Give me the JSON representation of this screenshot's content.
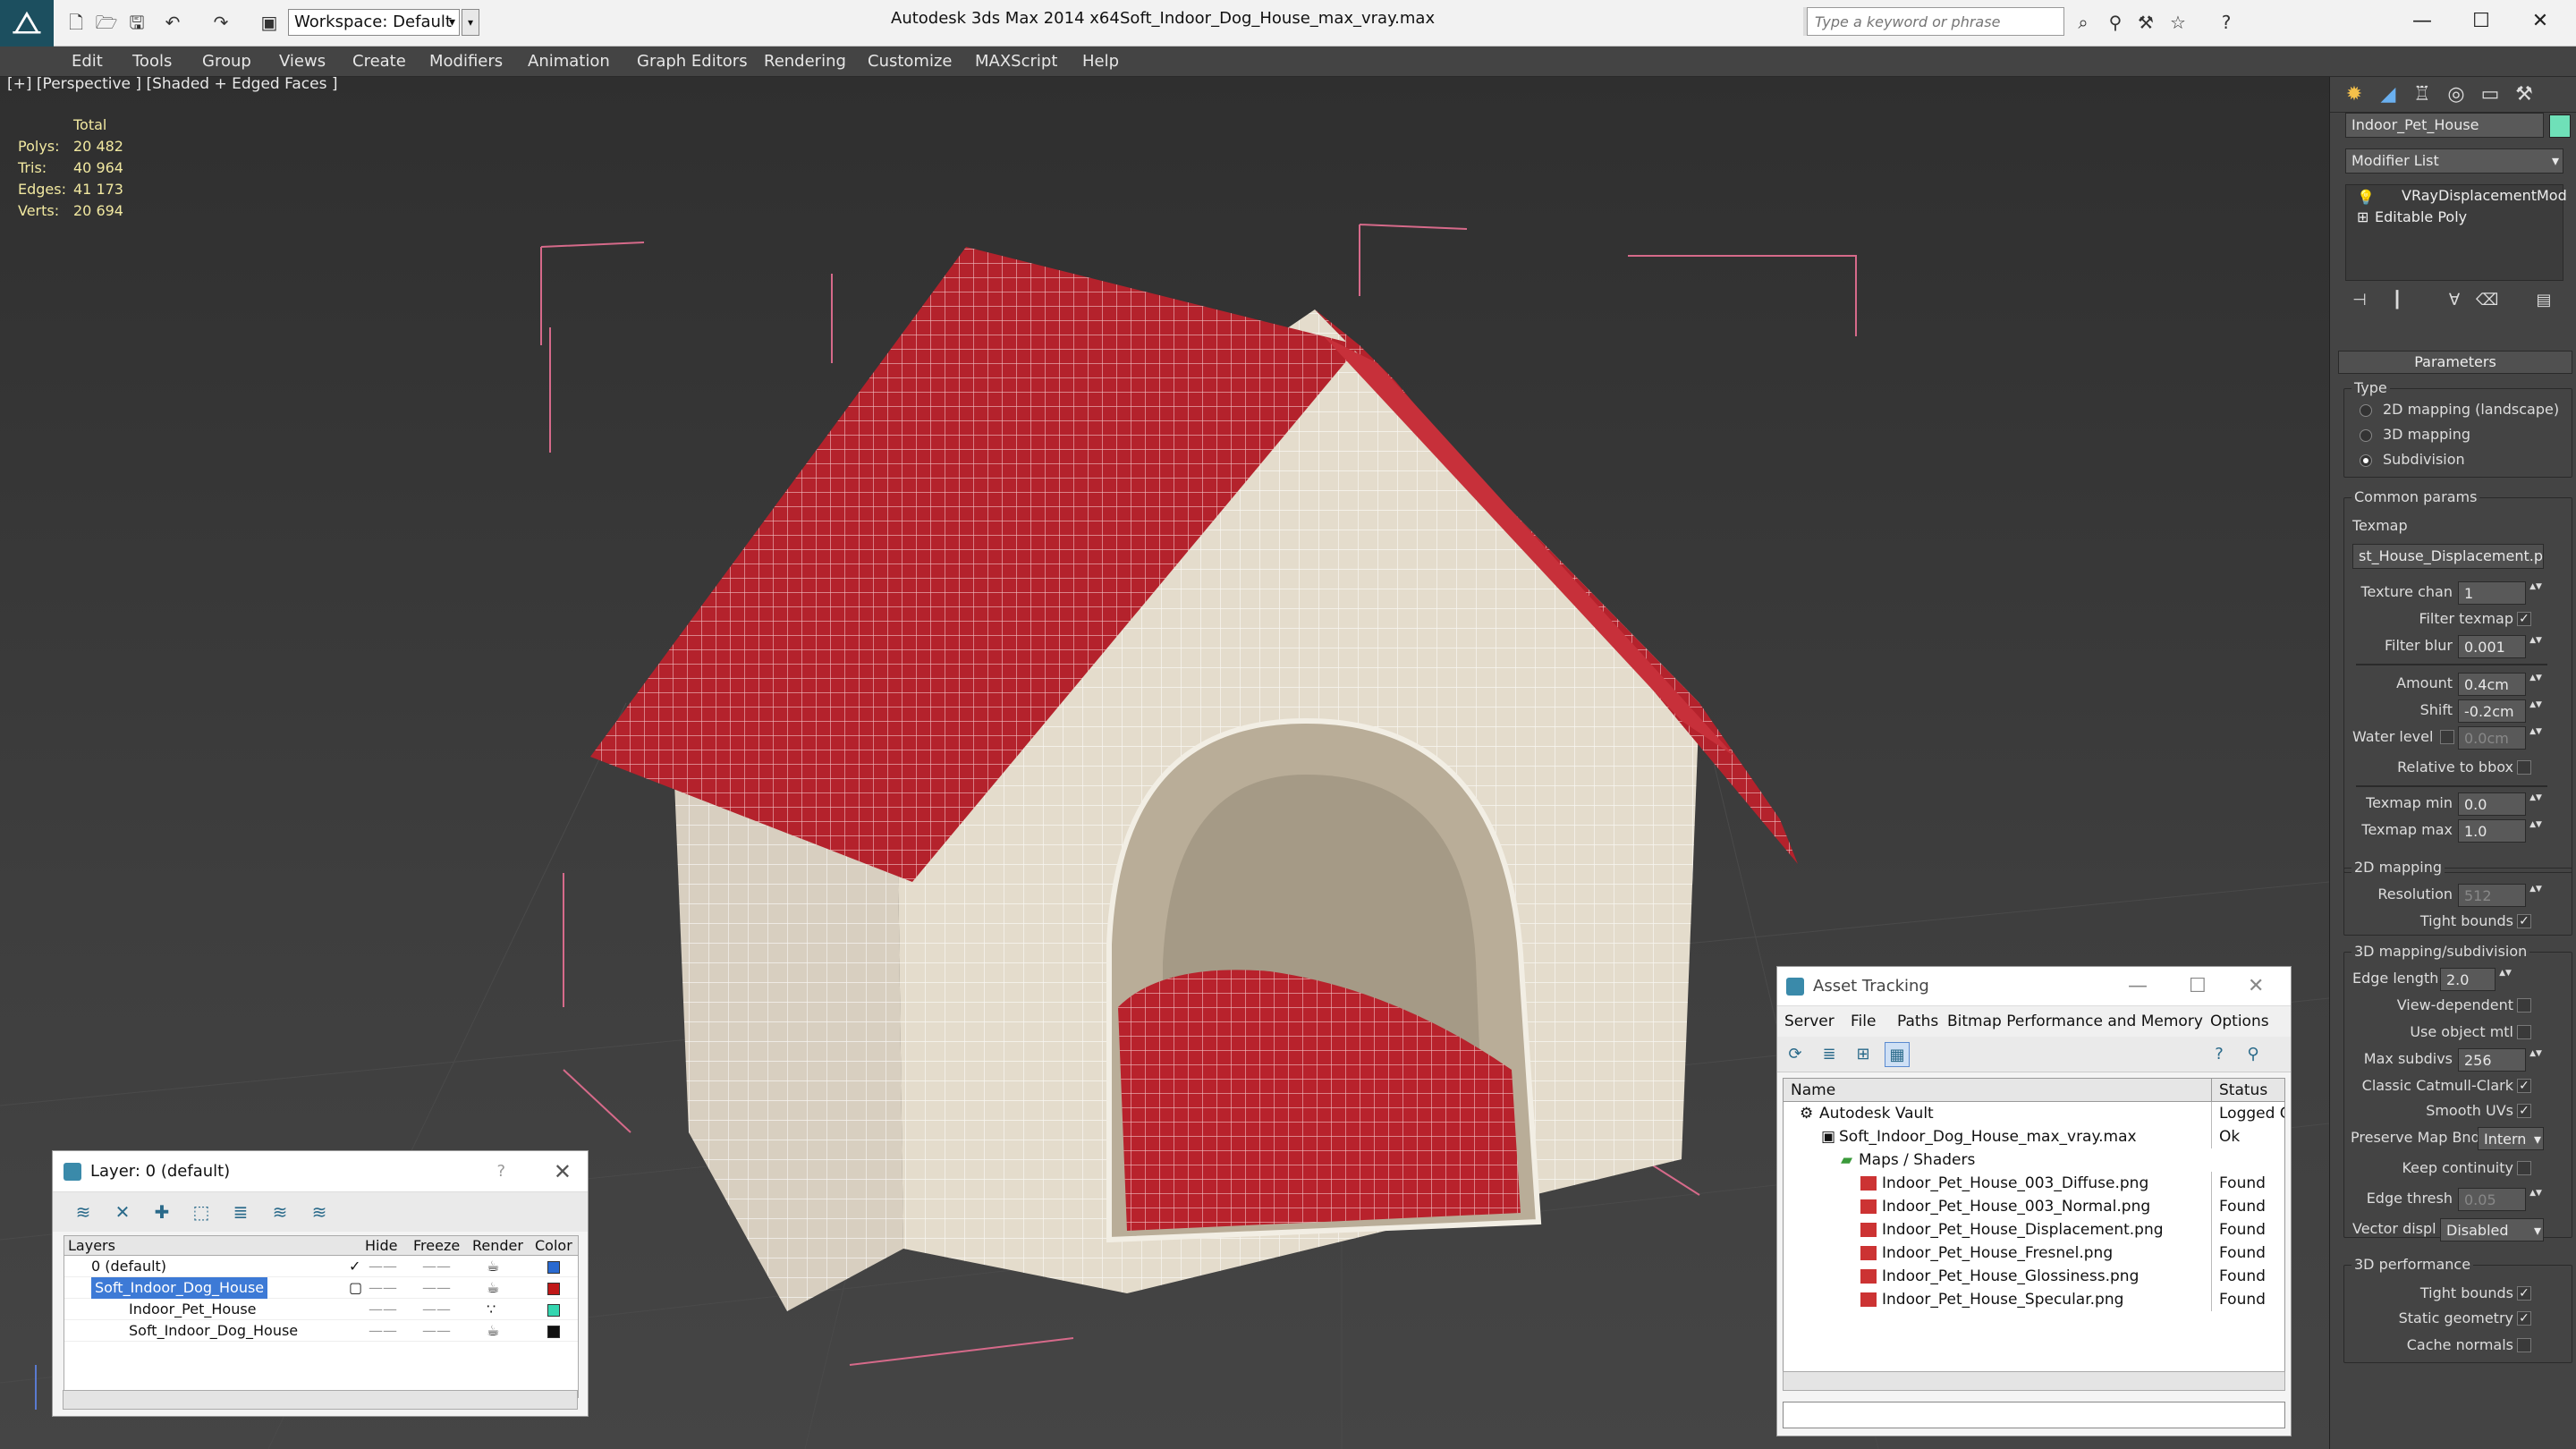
{
  "titlebar": {
    "app_title": "Autodesk 3ds Max  2014 x64",
    "file_title": "Soft_Indoor_Dog_House_max_vray.max",
    "workspace": "Workspace: Default",
    "search_placeholder": "Type a keyword or phrase"
  },
  "menu": [
    "Edit",
    "Tools",
    "Group",
    "Views",
    "Create",
    "Modifiers",
    "Animation",
    "Graph Editors",
    "Rendering",
    "Customize",
    "MAXScript",
    "Help"
  ],
  "viewport": {
    "label": "[+] [Perspective ] [Shaded + Edged Faces ]",
    "stats_header": "Total",
    "stats": [
      {
        "label": "Polys:",
        "value": "20 482"
      },
      {
        "label": "Tris:",
        "value": "40 964"
      },
      {
        "label": "Edges:",
        "value": "41 173"
      },
      {
        "label": "Verts:",
        "value": "20 694"
      }
    ]
  },
  "layer_window": {
    "title": "Layer: 0 (default)",
    "help": "?",
    "columns": [
      "Layers",
      "Hide",
      "Freeze",
      "Render",
      "Color"
    ],
    "rows": [
      {
        "name": "0 (default)",
        "color": "#2a6ad0",
        "indent": 0,
        "selected": false
      },
      {
        "name": "Soft_Indoor_Dog_House",
        "color": "#c01818",
        "indent": 0,
        "selected": true
      },
      {
        "name": "Indoor_Pet_House",
        "color": "#34d6b0",
        "indent": 1,
        "selected": false
      },
      {
        "name": "Soft_Indoor_Dog_House",
        "color": "#111111",
        "indent": 1,
        "selected": false
      }
    ]
  },
  "asset_window": {
    "title": "Asset Tracking",
    "menu": [
      "Server",
      "File",
      "Paths",
      "Bitmap Performance and Memory",
      "Options"
    ],
    "columns": [
      "Name",
      "Status"
    ],
    "rows": [
      {
        "name": "Autodesk Vault",
        "status": "Logged Ou",
        "indent": 0
      },
      {
        "name": "Soft_Indoor_Dog_House_max_vray.max",
        "status": "Ok",
        "indent": 1
      },
      {
        "name": "Maps / Shaders",
        "status": "",
        "indent": 2
      },
      {
        "name": "Indoor_Pet_House_003_Diffuse.png",
        "status": "Found",
        "indent": 3
      },
      {
        "name": "Indoor_Pet_House_003_Normal.png",
        "status": "Found",
        "indent": 3
      },
      {
        "name": "Indoor_Pet_House_Displacement.png",
        "status": "Found",
        "indent": 3
      },
      {
        "name": "Indoor_Pet_House_Fresnel.png",
        "status": "Found",
        "indent": 3
      },
      {
        "name": "Indoor_Pet_House_Glossiness.png",
        "status": "Found",
        "indent": 3
      },
      {
        "name": "Indoor_Pet_House_Specular.png",
        "status": "Found",
        "indent": 3
      }
    ]
  },
  "command_panel": {
    "object_name": "Indoor_Pet_House",
    "object_color": "#6fe0b8",
    "modifier_list": "Modifier List",
    "stack": [
      "VRayDisplacementMod",
      "Editable Poly"
    ],
    "parameters_title": "Parameters",
    "type_label": "Type",
    "type_options": [
      "2D mapping (landscape)",
      "3D mapping",
      "Subdivision"
    ],
    "type_selected": 2,
    "common_params": "Common params",
    "texmap_label": "Texmap",
    "texmap_value": "st_House_Displacement.png)",
    "texture_chan_label": "Texture chan",
    "texture_chan": "1",
    "filter_texmap": "Filter texmap",
    "filter_blur_label": "Filter blur",
    "filter_blur": "0.001",
    "amount_label": "Amount",
    "amount": "0.4cm",
    "shift_label": "Shift",
    "shift": "-0.2cm",
    "water_level_label": "Water level",
    "water_level": "0.0cm",
    "relative_bbox": "Relative to bbox",
    "texmap_min_label": "Texmap min",
    "texmap_min": "0.0",
    "texmap_max_label": "Texmap max",
    "texmap_max": "1.0",
    "mapping2d_title": "2D mapping",
    "resolution_label": "Resolution",
    "resolution": "512",
    "tight_bounds": "Tight bounds",
    "mapping3d_title": "3D mapping/subdivision",
    "edge_length_label": "Edge length",
    "edge_length": "2.0",
    "view_dependent": "View-dependent",
    "use_object_mtl": "Use object mtl",
    "max_subdivs_label": "Max subdivs",
    "max_subdivs": "256",
    "classic_catmull": "Classic Catmull-Clark",
    "smooth_uvs": "Smooth UVs",
    "preserve_map_label": "Preserve Map Bnd",
    "preserve_map": "Intern",
    "keep_continuity": "Keep continuity",
    "edge_thresh_label": "Edge thresh",
    "edge_thresh": "0.05",
    "vector_displ_label": "Vector displ",
    "vector_displ": "Disabled",
    "perf_title": "3D performance",
    "tight_bounds2": "Tight bounds",
    "static_geometry": "Static geometry",
    "cache_normals": "Cache normals"
  }
}
